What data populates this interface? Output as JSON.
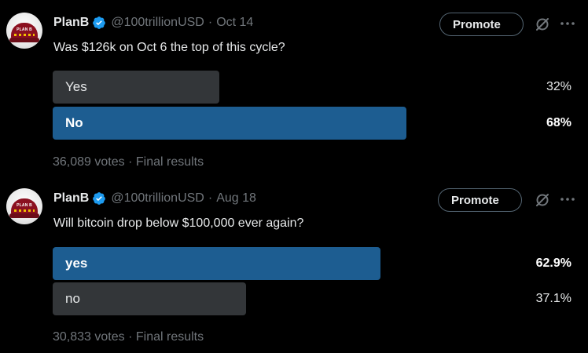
{
  "tweets": [
    {
      "author": {
        "name": "PlanB",
        "handle": "@100trillionUSD",
        "date": "Oct 14",
        "verified": true
      },
      "avatar_icon": "avatar-icon",
      "promote_label": "Promote",
      "question": "Was $126k on Oct 6 the top of this cycle?",
      "options": [
        {
          "label": "Yes",
          "percent": "32%",
          "value": 32,
          "winner": false
        },
        {
          "label": "No",
          "percent": "68%",
          "value": 68,
          "winner": true
        }
      ],
      "votes": "36,089 votes",
      "status": "Final results"
    },
    {
      "author": {
        "name": "PlanB",
        "handle": "@100trillionUSD",
        "date": "Aug 18",
        "verified": true
      },
      "avatar_icon": "avatar-icon",
      "promote_label": "Promote",
      "question": "Will bitcoin drop below $100,000 ever again?",
      "options": [
        {
          "label": "yes",
          "percent": "62.9%",
          "value": 62.9,
          "winner": true
        },
        {
          "label": "no",
          "percent": "37.1%",
          "value": 37.1,
          "winner": false
        }
      ],
      "votes": "30,833 votes",
      "status": "Final results"
    }
  ],
  "separator": "·",
  "avatar_cap_text": "PLAN B",
  "icons": {
    "verified": "verified-badge-icon",
    "grok": "grok-icon",
    "more": "more-icon"
  },
  "colors": {
    "background": "#000000",
    "winner_bar": "#1d5d91",
    "loser_bar": "#333639",
    "secondary_text": "#71767b",
    "verified": "#1d9bf0"
  }
}
